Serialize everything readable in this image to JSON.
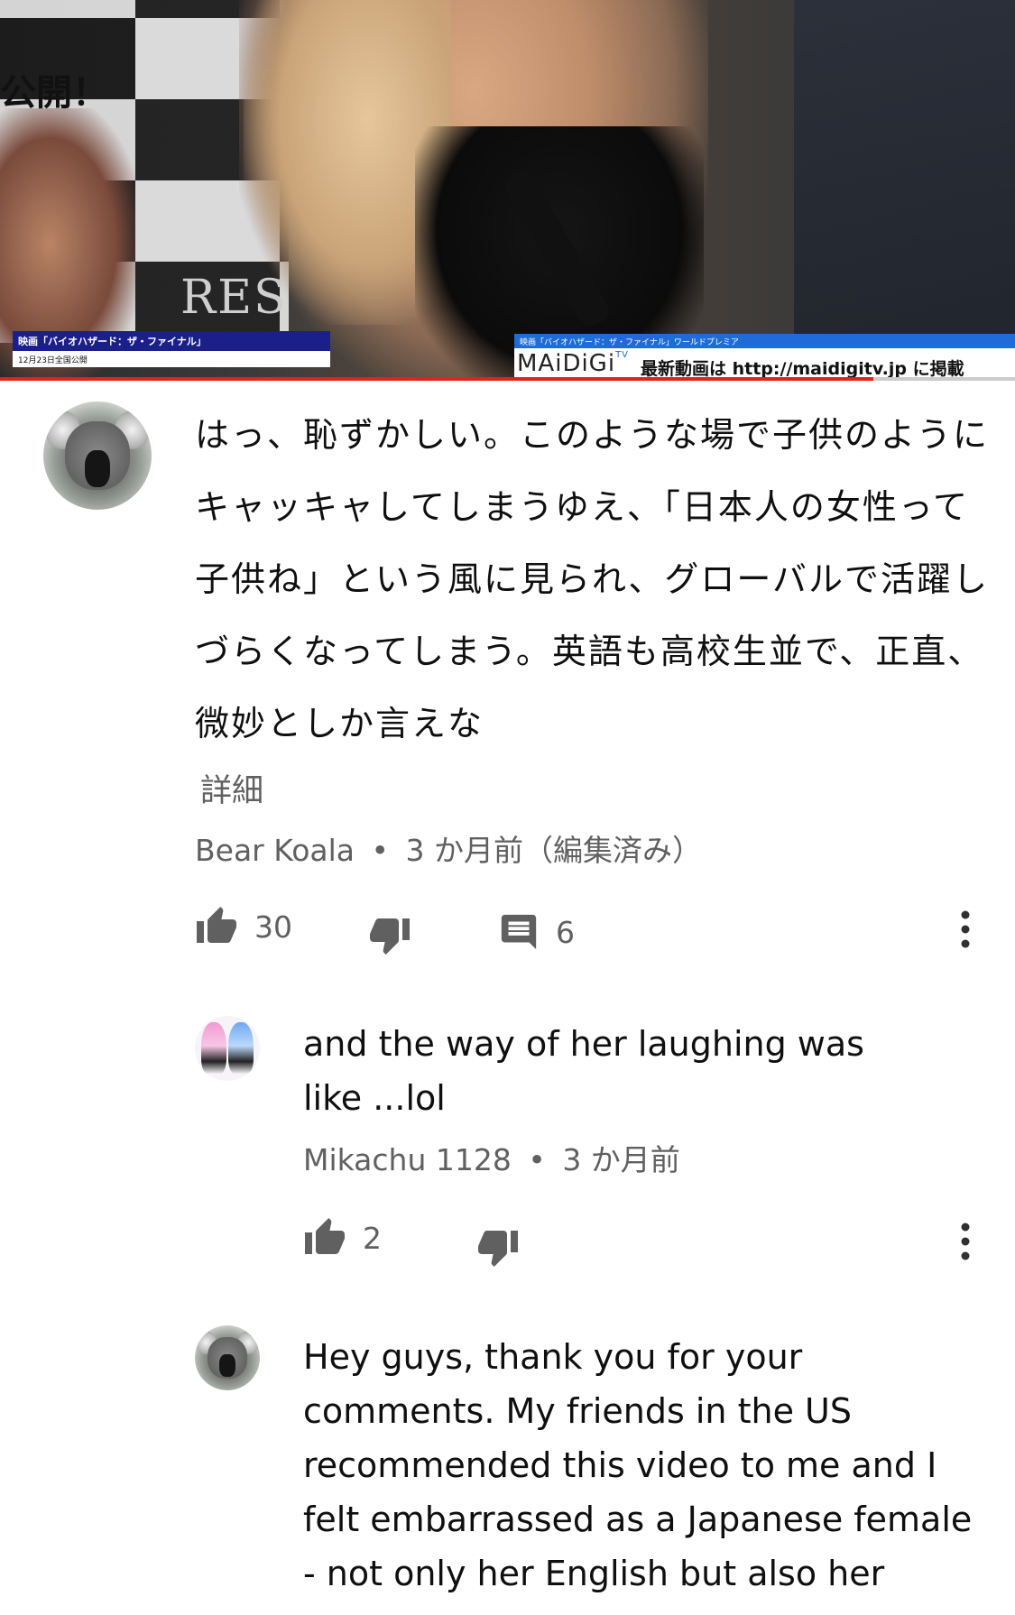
{
  "video": {
    "poster_text": "公開！",
    "caption_left_title": "映画「バイオハザード：ザ・ファイナル」",
    "caption_left_date": "12月23日全国公開",
    "caption_right_title": "映画「バイオハザード：ザ・ファイナル」ワールドプレミア",
    "caption_right_logo": "MAiDiGi",
    "caption_right_logo_tv": "TV",
    "caption_right_text": "最新動画は http://maidigitv.jp に掲載",
    "backdrop_logo": "RES",
    "progress_fraction": 0.86,
    "colors": {
      "progress": "#e62117",
      "caption_left_bar": "#1b1f8a",
      "caption_right_bar": "#1f6bd8"
    }
  },
  "comment": {
    "avatar_icon": "koala-avatar",
    "text": "はっ、恥ずかしい。このような場で子供のようにキャッキャしてしまうゆえ、「日本人の女性って子供ね」という風に見られ、グローバルで活躍しづらくなってしまう。英語も高校生並で、正直、微妙としか言えな",
    "more_label": "詳細",
    "author": "Bear Koala",
    "time": "3 か月前（編集済み）",
    "likes": "30",
    "replies": "6"
  },
  "replies": [
    {
      "avatar_icon": "anime-twins-avatar",
      "text_line1": "and the way of her laughing was",
      "text_line2": "like ...lol",
      "author": "Mikachu 1128",
      "time": "3 か月前",
      "likes": "2"
    },
    {
      "avatar_icon": "koala-avatar",
      "lines": [
        "Hey guys, thank you for your",
        "comments. My friends in the US",
        "recommended this video to me and I",
        "felt embarrassed as a Japanese female",
        "- not only her English but also her"
      ]
    }
  ],
  "separator": "•",
  "icons": [
    "thumb-up-icon",
    "thumb-down-icon",
    "comment-icon",
    "more-vert-icon"
  ]
}
